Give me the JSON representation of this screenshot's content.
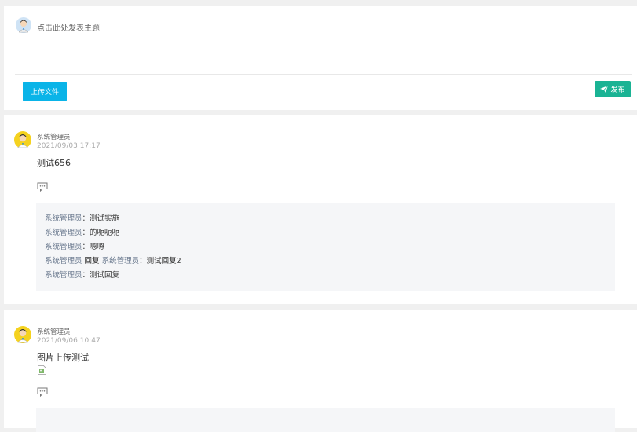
{
  "composer": {
    "placeholder": "点击此处发表主题",
    "upload_label": "上传文件",
    "publish_label": "发布"
  },
  "posts": [
    {
      "author": "系统管理员",
      "time": "2021/09/03 17:17",
      "content": "测试656",
      "replies": [
        {
          "user": "系统管理员",
          "sep": "：",
          "text": "测试实施"
        },
        {
          "user": "系统管理员",
          "sep": "：",
          "text": "的呃呃呃"
        },
        {
          "user": "系统管理员",
          "sep": "：",
          "text": "嗯嗯"
        },
        {
          "user": "系统管理员",
          "mid": " 回复 ",
          "user2": "系统管理员",
          "sep": "：",
          "text": "测试回复2"
        },
        {
          "user": "系统管理员",
          "sep": "：",
          "text": "测试回复"
        }
      ]
    },
    {
      "author": "系统管理员",
      "time": "2021/09/06 10:47",
      "content": "图片上传测试"
    }
  ],
  "colors": {
    "upload_button": "#0ab4e8",
    "publish_button": "#1ab394",
    "reply_user": "#6b7a8f"
  },
  "icons": [
    "user-avatar",
    "paper-plane-icon",
    "comment-icon",
    "broken-image-icon"
  ]
}
